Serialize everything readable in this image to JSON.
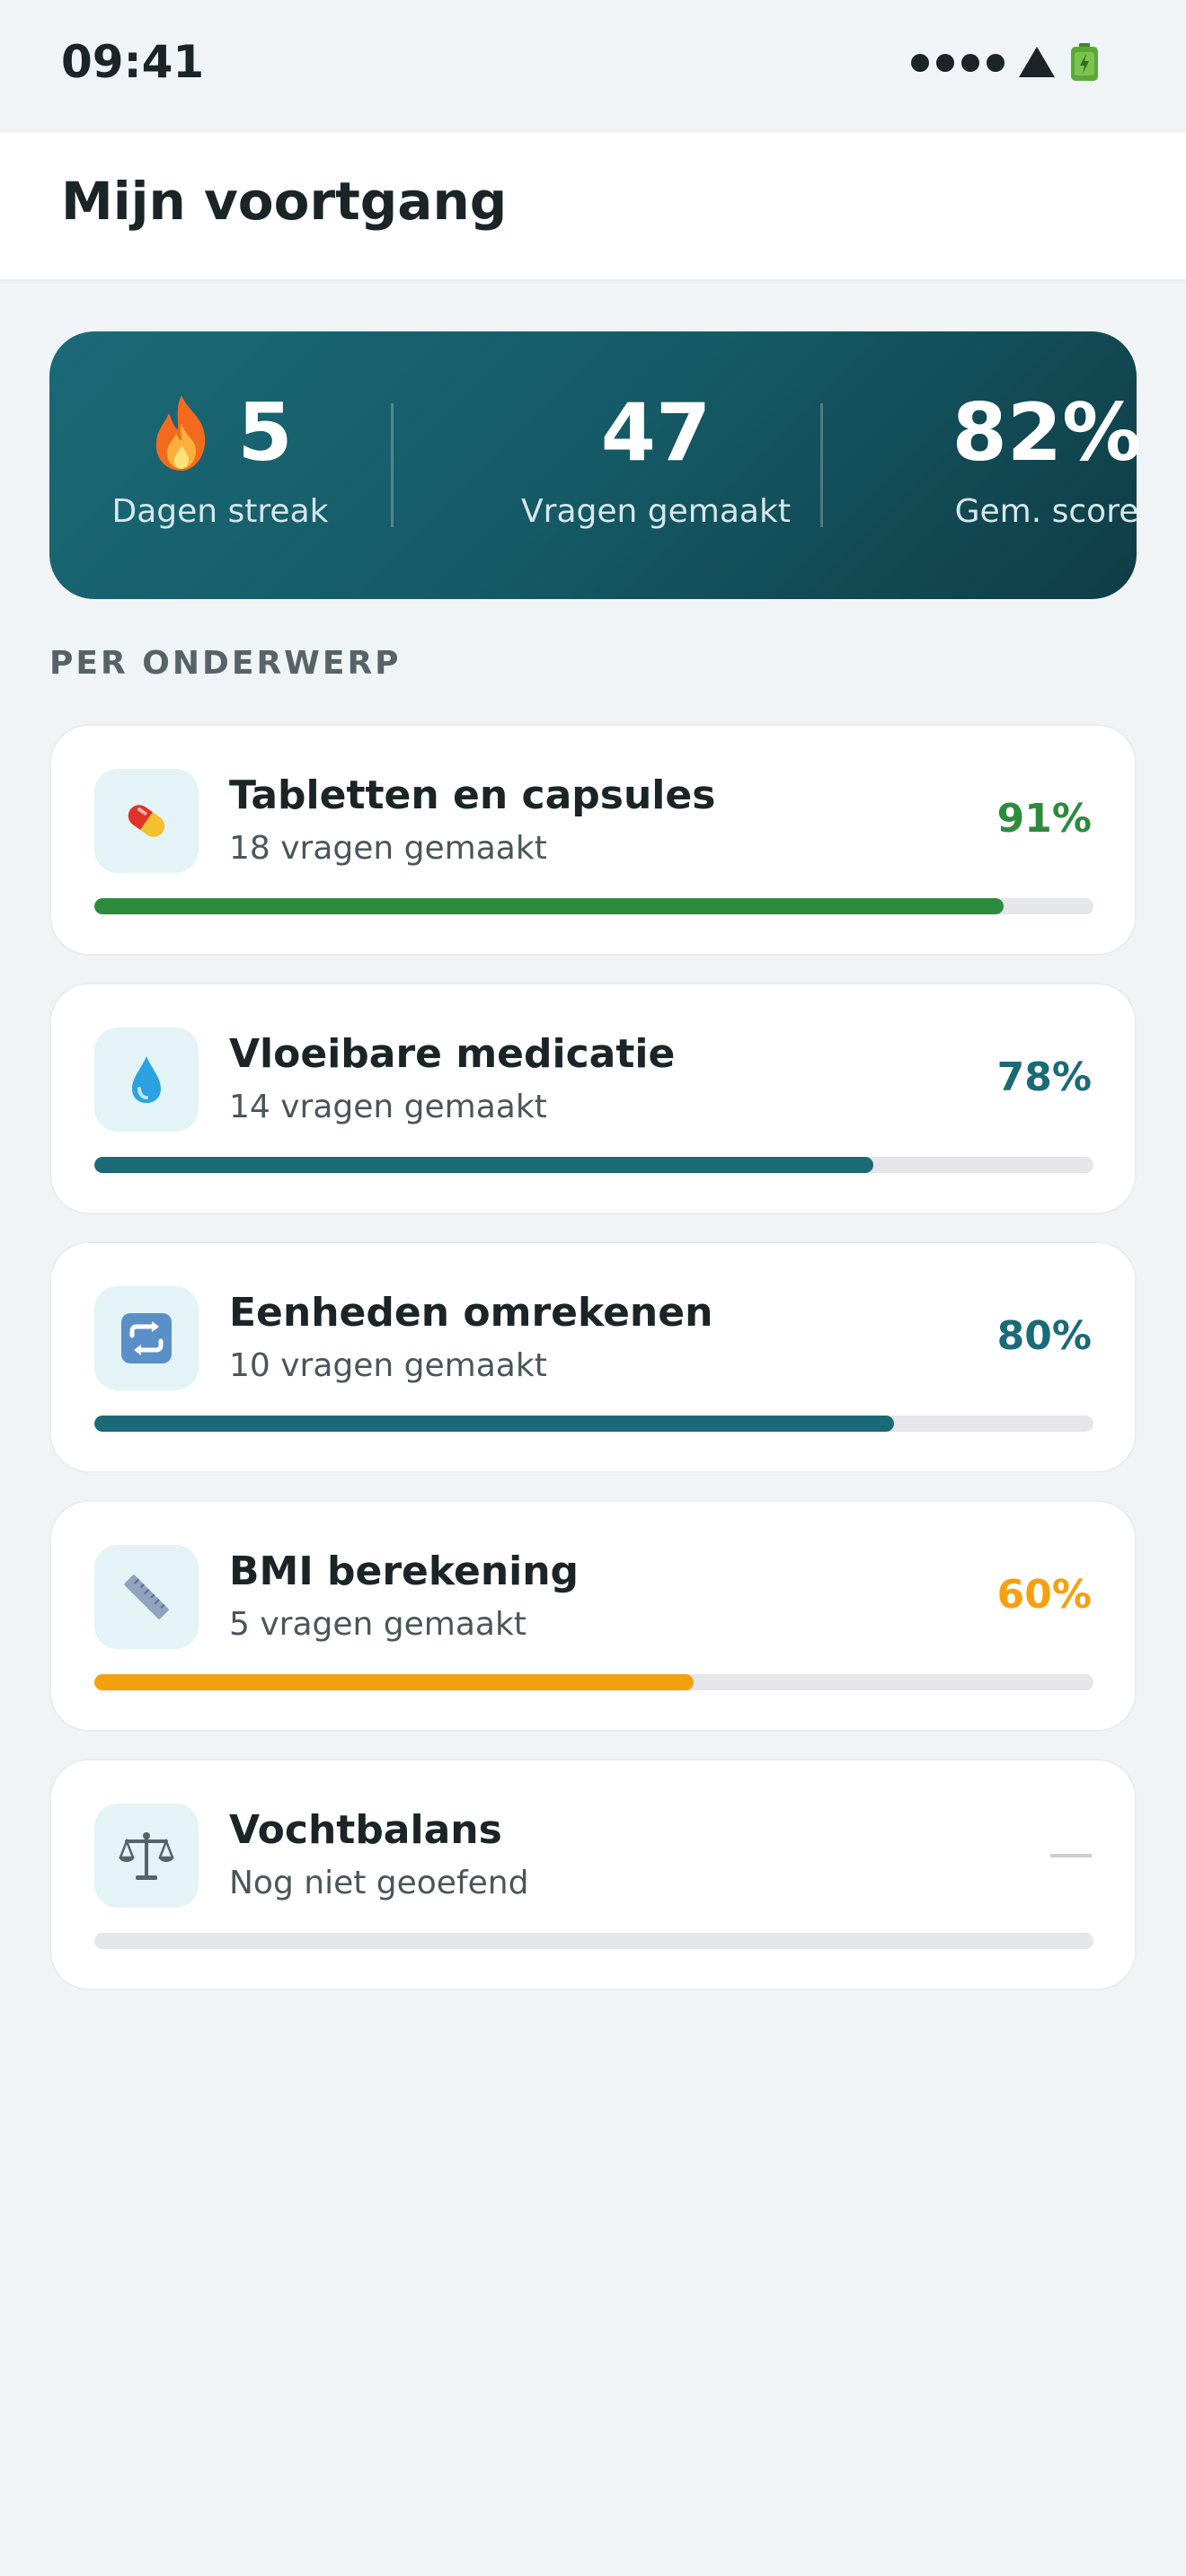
{
  "status_bar": {
    "time": "09:41"
  },
  "header": {
    "title": "Mijn voortgang"
  },
  "summary": {
    "streak": {
      "value": "5",
      "label": "Dagen streak",
      "icon": "fire-icon"
    },
    "questions": {
      "value": "47",
      "label": "Vragen gemaakt"
    },
    "score": {
      "value": "82%",
      "label": "Gem. score"
    }
  },
  "section": {
    "heading": "PER ONDERWERP"
  },
  "topics": [
    {
      "name": "Tabletten en capsules",
      "sub": "18 vragen gemaakt",
      "percent": "91%",
      "progress": 0.91,
      "color": "#2e8b3e",
      "icon": "pill-icon"
    },
    {
      "name": "Vloeibare medicatie",
      "sub": "14 vragen gemaakt",
      "percent": "78%",
      "progress": 0.78,
      "color": "#1b6a77",
      "icon": "droplet-icon"
    },
    {
      "name": "Eenheden omrekenen",
      "sub": "10 vragen gemaakt",
      "percent": "80%",
      "progress": 0.8,
      "color": "#1b6a77",
      "icon": "repeat-icon"
    },
    {
      "name": "BMI berekening",
      "sub": "5 vragen gemaakt",
      "percent": "60%",
      "progress": 0.6,
      "color": "#f5a00f",
      "icon": "ruler-icon"
    },
    {
      "name": "Vochtbalans",
      "sub": "Nog niet geoefend",
      "percent": "",
      "progress": 0,
      "color": "#c9ced2",
      "icon": "scale-icon"
    }
  ],
  "colors": {
    "accent": "#1b6a77",
    "good": "#2e8b3e",
    "warning": "#f5a00f"
  }
}
